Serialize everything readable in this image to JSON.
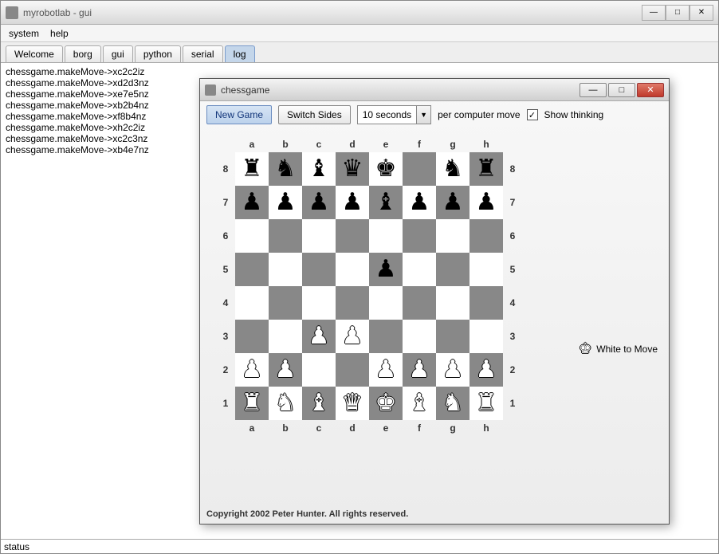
{
  "main": {
    "title": "myrobotlab - gui",
    "menu": {
      "system": "system",
      "help": "help"
    },
    "tabs": {
      "welcome": "Welcome",
      "borg": "borg",
      "gui": "gui",
      "python": "python",
      "serial": "serial",
      "log": "log"
    },
    "active_tab": "log",
    "log_lines": [
      "chessgame.makeMove->xc2c2iz",
      "chessgame.makeMove->xd2d3nz",
      "chessgame.makeMove->xe7e5nz",
      "chessgame.makeMove->xb2b4nz",
      "chessgame.makeMove->xf8b4nz",
      "chessgame.makeMove->xh2c2iz",
      "chessgame.makeMove->xc2c3nz",
      "chessgame.makeMove->xb4e7nz"
    ],
    "status": "status"
  },
  "child": {
    "title": "chessgame",
    "buttons": {
      "new_game": "New Game",
      "switch_sides": "Switch Sides"
    },
    "combo": {
      "value": "10 seconds"
    },
    "labels": {
      "per_move": "per computer move",
      "show_thinking": "Show thinking"
    },
    "checkbox_checked": true,
    "turn_text": "White to Move",
    "copyright": "Copyright 2002 Peter Hunter. All rights reserved.",
    "files": [
      "a",
      "b",
      "c",
      "d",
      "e",
      "f",
      "g",
      "h"
    ],
    "ranks": [
      "8",
      "7",
      "6",
      "5",
      "4",
      "3",
      "2",
      "1"
    ],
    "board": [
      [
        {
          "p": "r",
          "c": "b"
        },
        {
          "p": "n",
          "c": "b"
        },
        {
          "p": "b",
          "c": "b"
        },
        {
          "p": "q",
          "c": "b"
        },
        {
          "p": "k",
          "c": "b"
        },
        {
          "p": "",
          "c": ""
        },
        {
          "p": "n",
          "c": "b"
        },
        {
          "p": "r",
          "c": "b"
        }
      ],
      [
        {
          "p": "p",
          "c": "b"
        },
        {
          "p": "p",
          "c": "b"
        },
        {
          "p": "p",
          "c": "b"
        },
        {
          "p": "p",
          "c": "b"
        },
        {
          "p": "b",
          "c": "b"
        },
        {
          "p": "p",
          "c": "b"
        },
        {
          "p": "p",
          "c": "b"
        },
        {
          "p": "p",
          "c": "b"
        }
      ],
      [
        {
          "p": "",
          "c": ""
        },
        {
          "p": "",
          "c": ""
        },
        {
          "p": "",
          "c": ""
        },
        {
          "p": "",
          "c": ""
        },
        {
          "p": "",
          "c": ""
        },
        {
          "p": "",
          "c": ""
        },
        {
          "p": "",
          "c": ""
        },
        {
          "p": "",
          "c": ""
        }
      ],
      [
        {
          "p": "",
          "c": ""
        },
        {
          "p": "",
          "c": ""
        },
        {
          "p": "",
          "c": ""
        },
        {
          "p": "",
          "c": ""
        },
        {
          "p": "p",
          "c": "b"
        },
        {
          "p": "",
          "c": ""
        },
        {
          "p": "",
          "c": ""
        },
        {
          "p": "",
          "c": ""
        }
      ],
      [
        {
          "p": "",
          "c": ""
        },
        {
          "p": "",
          "c": ""
        },
        {
          "p": "",
          "c": ""
        },
        {
          "p": "",
          "c": ""
        },
        {
          "p": "",
          "c": ""
        },
        {
          "p": "",
          "c": ""
        },
        {
          "p": "",
          "c": ""
        },
        {
          "p": "",
          "c": ""
        }
      ],
      [
        {
          "p": "",
          "c": ""
        },
        {
          "p": "",
          "c": ""
        },
        {
          "p": "p",
          "c": "w"
        },
        {
          "p": "p",
          "c": "w"
        },
        {
          "p": "",
          "c": ""
        },
        {
          "p": "",
          "c": ""
        },
        {
          "p": "",
          "c": ""
        },
        {
          "p": "",
          "c": ""
        }
      ],
      [
        {
          "p": "p",
          "c": "w"
        },
        {
          "p": "p",
          "c": "w"
        },
        {
          "p": "",
          "c": ""
        },
        {
          "p": "",
          "c": ""
        },
        {
          "p": "p",
          "c": "w"
        },
        {
          "p": "p",
          "c": "w"
        },
        {
          "p": "p",
          "c": "w"
        },
        {
          "p": "p",
          "c": "w"
        }
      ],
      [
        {
          "p": "r",
          "c": "w"
        },
        {
          "p": "n",
          "c": "w"
        },
        {
          "p": "b",
          "c": "w"
        },
        {
          "p": "q",
          "c": "w"
        },
        {
          "p": "k",
          "c": "w"
        },
        {
          "p": "b",
          "c": "w"
        },
        {
          "p": "n",
          "c": "w"
        },
        {
          "p": "r",
          "c": "w"
        }
      ]
    ],
    "glyphs": {
      "k": "♚",
      "q": "♛",
      "r": "♜",
      "b": "♝",
      "n": "♞",
      "p": "♟"
    }
  }
}
